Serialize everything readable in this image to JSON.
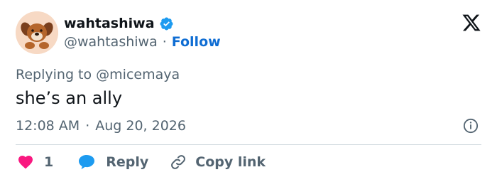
{
  "author": {
    "display_name": "wahtashiwa",
    "handle": "@wahtashiwa",
    "separator": "·",
    "follow_label": "Follow"
  },
  "tweet": {
    "replying_prefix": "Replying to ",
    "replying_to": "@micemaya",
    "text": "she’s an ally",
    "time": "12:08 AM",
    "meta_separator": "·",
    "date": "Aug 20, 2026"
  },
  "actions": {
    "like_count": "1",
    "reply_label": "Reply",
    "copy_link_label": "Copy link"
  },
  "colors": {
    "like": "#f91880",
    "reply": "#1d9bf0",
    "link": "#0f6dd3",
    "verified": "#1d9bf0",
    "muted": "#536471"
  },
  "icons": {
    "avatar": "dog-avatar",
    "verified": "verified-badge-icon",
    "logo": "x-logo-icon",
    "info": "info-icon",
    "like": "heart-icon",
    "reply": "speech-bubble-icon",
    "copy": "link-icon"
  }
}
